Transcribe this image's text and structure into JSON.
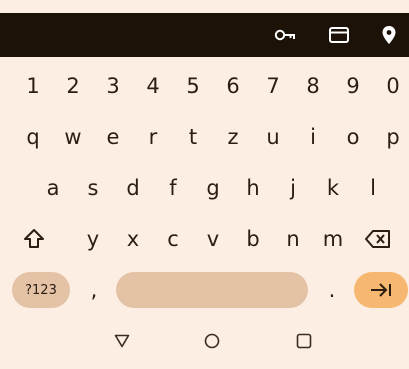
{
  "toolbar": {
    "icons": [
      "key-icon",
      "credit-card-icon",
      "location-pin-icon"
    ]
  },
  "rows": {
    "numbers": [
      "1",
      "2",
      "3",
      "4",
      "5",
      "6",
      "7",
      "8",
      "9",
      "0"
    ],
    "top": [
      "q",
      "w",
      "e",
      "r",
      "t",
      "z",
      "u",
      "i",
      "o",
      "p"
    ],
    "middle": [
      "a",
      "s",
      "d",
      "f",
      "g",
      "h",
      "j",
      "k",
      "l"
    ],
    "bottom": [
      "y",
      "x",
      "c",
      "v",
      "b",
      "n",
      "m"
    ]
  },
  "bottom_row": {
    "symbols_label": "?123",
    "comma_label": ",",
    "period_label": "."
  },
  "colors": {
    "background": "#fdeee3",
    "toolbar": "#1d1208",
    "key_text": "#2b1d12",
    "symbols_key": "#e3c2a6",
    "spacebar": "#e3c2a6",
    "enter_key": "#f6b870"
  },
  "nav": {
    "icons": [
      "back-triangle-icon",
      "home-circle-icon",
      "recents-square-icon"
    ]
  }
}
